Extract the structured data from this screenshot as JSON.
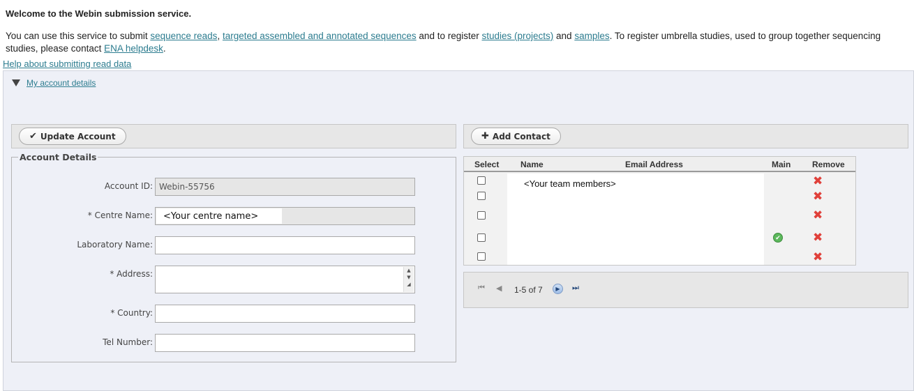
{
  "header": {
    "welcome": "Welcome to the Webin submission service.",
    "intro_1": "You can use this service to submit ",
    "link_reads": "sequence reads",
    "sep_1": ", ",
    "link_targeted": "targeted assembled and annotated sequences",
    "intro_2": " and to register ",
    "link_studies": "studies (projects)",
    "intro_3": " and ",
    "link_samples": "samples",
    "intro_4": ". To register umbrella studies, used to group together sequencing studies, please contact ",
    "link_helpdesk": "ENA helpdesk",
    "intro_5": ".",
    "help_link": "Help about submitting read data"
  },
  "account_panel": {
    "toggle_label": "My account details",
    "update_button": "Update Account",
    "add_contact_button": "Add Contact",
    "legend": "Account Details",
    "fields": {
      "account_id_label": "Account ID:",
      "account_id_value": "Webin-55756",
      "centre_name_label": "* Centre Name:",
      "centre_name_value": "<Your centre name>",
      "lab_name_label": "Laboratory Name:",
      "lab_name_value": "",
      "address_label": "* Address:",
      "address_value": "",
      "country_label": "* Country:",
      "country_value": "",
      "tel_label": "Tel Number:",
      "tel_value": ""
    }
  },
  "contacts": {
    "columns": {
      "select": "Select",
      "name": "Name",
      "email": "Email Address",
      "main": "Main",
      "remove": "Remove"
    },
    "placeholder": "<Your team members>",
    "remove_glyph": "✖",
    "main_glyph": "✔",
    "pager": {
      "info": "1-5 of 7"
    }
  }
}
